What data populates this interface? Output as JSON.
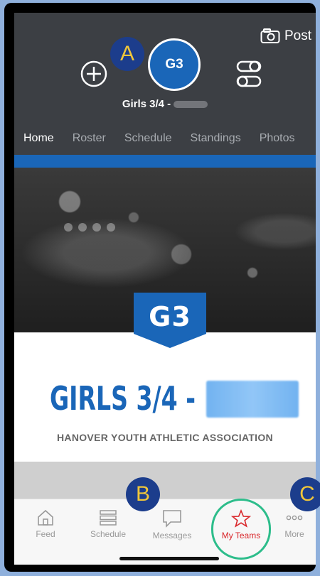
{
  "header": {
    "post_label": "Post",
    "team_avatar": "G3",
    "team_name": "Girls 3/4 -",
    "icons": [
      "camera-icon",
      "add-circle-icon",
      "toggle-settings-icon"
    ]
  },
  "tabs": [
    {
      "label": "Home",
      "active": true
    },
    {
      "label": "Roster",
      "active": false
    },
    {
      "label": "Schedule",
      "active": false
    },
    {
      "label": "Standings",
      "active": false
    },
    {
      "label": "Photos",
      "active": false
    }
  ],
  "hero": {
    "badge": "G3",
    "title": "GIRLS 3/4 -",
    "association": "HANOVER YOUTH ATHLETIC ASSOCIATION"
  },
  "tabbar": [
    {
      "label": "Feed",
      "icon": "home-icon",
      "active": false
    },
    {
      "label": "Schedule",
      "icon": "list-icon",
      "active": false
    },
    {
      "label": "Messages",
      "icon": "chat-bubble-icon",
      "active": false
    },
    {
      "label": "My Teams",
      "icon": "star-icon",
      "active": true
    },
    {
      "label": "More",
      "icon": "more-dots-icon",
      "active": false
    }
  ],
  "callouts": {
    "a": "A",
    "b": "B",
    "c": "C"
  },
  "colors": {
    "accent_blue": "#1a66b8",
    "active_red": "#d9262a",
    "header_dark": "#3c3f44",
    "highlight_green": "#2dbd8b",
    "callout_navy": "#1c3d8c",
    "callout_gold": "#f0c63a"
  }
}
